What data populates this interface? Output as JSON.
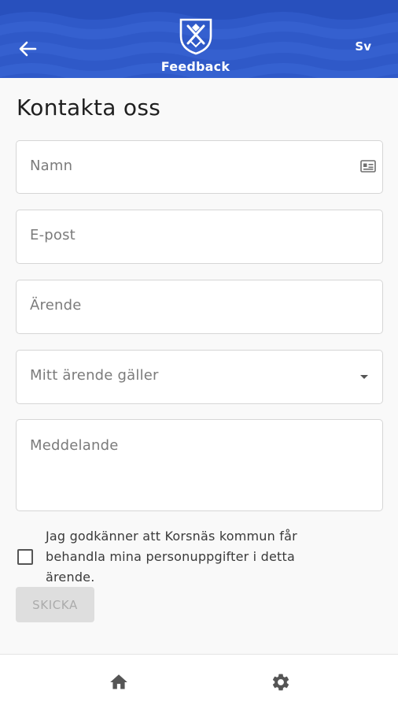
{
  "header": {
    "title": "Feedback",
    "language": "Sv",
    "back_icon": "arrow-left-icon",
    "logo_icon": "coat-of-arms-icon",
    "background": "#2f59c8"
  },
  "form": {
    "title": "Kontakta oss",
    "name_placeholder": "Namn",
    "email_placeholder": "E-post",
    "subject_placeholder": "Ärende",
    "category_placeholder": "Mitt ärende gäller",
    "message_placeholder": "Meddelande",
    "consent_text": "Jag godkänner att Korsnäs kommun får behandla mina personuppgifter i detta ärende.",
    "consent_checked": false,
    "submit_label": "SKICKA",
    "submit_enabled": false
  },
  "bottom_nav": {
    "items": [
      {
        "icon": "home-icon"
      },
      {
        "icon": "gear-icon"
      }
    ]
  }
}
